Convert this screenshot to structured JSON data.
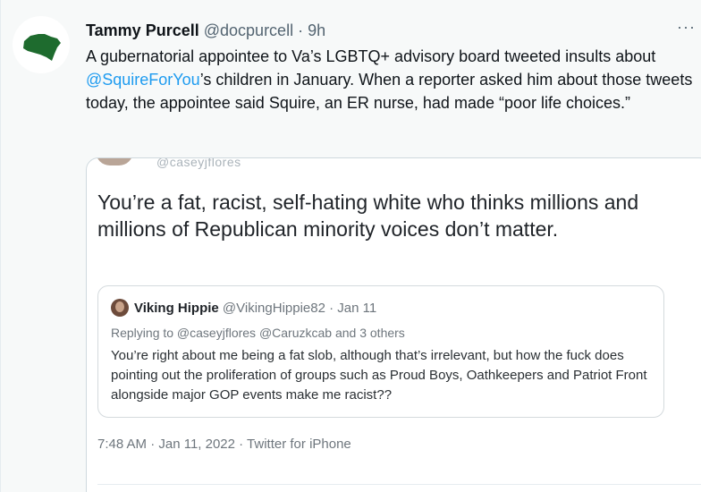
{
  "tweet": {
    "author_name": "Tammy Purcell",
    "author_handle": "@docpurcell",
    "separator": "·",
    "time": "9h",
    "more_label": "···",
    "text_part1": "A gubernatorial appointee to Va’s LGBTQ+ advisory board tweeted insults about ",
    "mention": "@SquireForYou",
    "text_part2": "’s children in January. When a reporter asked him about those tweets today, the appointee said Squire, an ER nurse, had made “poor life choices.”"
  },
  "embedded": {
    "peek_handle": "@caseyjflores",
    "main_text": "You’re a fat, racist, self-hating white who thinks millions and millions of Republican minority voices don’t matter.",
    "quote": {
      "author_name": "Viking Hippie",
      "author_handle": "@VikingHippie82",
      "separator": "·",
      "date": "Jan 11",
      "replying_to": "Replying to @caseyjflores @Caruzkcab and 3 others",
      "text": "You’re right about me being a fat slob, although that’s irrelevant, but how the fuck does pointing out the proliferation of groups such as Proud Boys, Oathkeepers and Patriot Front alongside major GOP events make me racist??"
    },
    "meta": "7:48 AM · Jan 11, 2022 · Twitter for iPhone"
  },
  "colors": {
    "link": "#1d9bf0",
    "secondary_text": "#536471",
    "avatar_shape": "#1e6b2e"
  },
  "icons": {
    "avatar": "virginia-map-icon",
    "more": "ellipsis-icon"
  }
}
